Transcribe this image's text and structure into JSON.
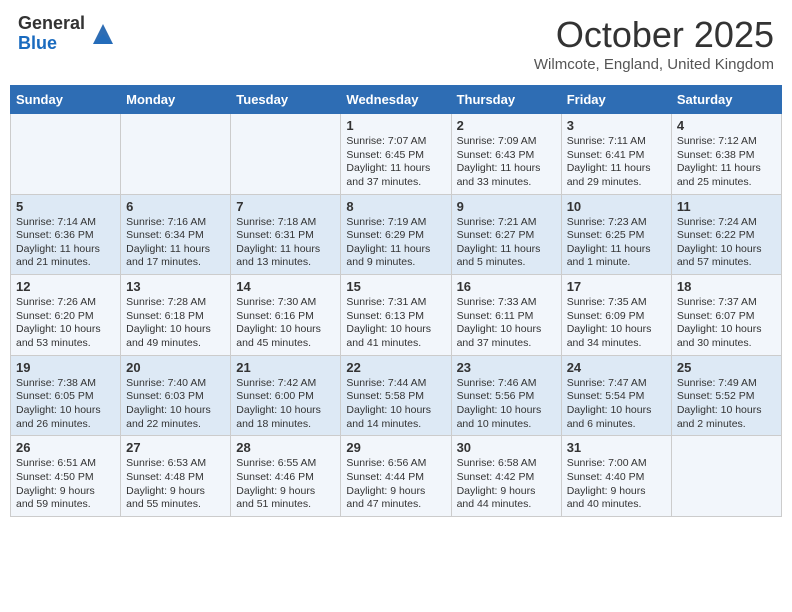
{
  "header": {
    "logo_general": "General",
    "logo_blue": "Blue",
    "title": "October 2025",
    "subtitle": "Wilmcote, England, United Kingdom"
  },
  "days_of_week": [
    "Sunday",
    "Monday",
    "Tuesday",
    "Wednesday",
    "Thursday",
    "Friday",
    "Saturday"
  ],
  "weeks": [
    [
      {
        "day": "",
        "text": ""
      },
      {
        "day": "",
        "text": ""
      },
      {
        "day": "",
        "text": ""
      },
      {
        "day": "1",
        "text": "Sunrise: 7:07 AM\nSunset: 6:45 PM\nDaylight: 11 hours and 37 minutes."
      },
      {
        "day": "2",
        "text": "Sunrise: 7:09 AM\nSunset: 6:43 PM\nDaylight: 11 hours and 33 minutes."
      },
      {
        "day": "3",
        "text": "Sunrise: 7:11 AM\nSunset: 6:41 PM\nDaylight: 11 hours and 29 minutes."
      },
      {
        "day": "4",
        "text": "Sunrise: 7:12 AM\nSunset: 6:38 PM\nDaylight: 11 hours and 25 minutes."
      }
    ],
    [
      {
        "day": "5",
        "text": "Sunrise: 7:14 AM\nSunset: 6:36 PM\nDaylight: 11 hours and 21 minutes."
      },
      {
        "day": "6",
        "text": "Sunrise: 7:16 AM\nSunset: 6:34 PM\nDaylight: 11 hours and 17 minutes."
      },
      {
        "day": "7",
        "text": "Sunrise: 7:18 AM\nSunset: 6:31 PM\nDaylight: 11 hours and 13 minutes."
      },
      {
        "day": "8",
        "text": "Sunrise: 7:19 AM\nSunset: 6:29 PM\nDaylight: 11 hours and 9 minutes."
      },
      {
        "day": "9",
        "text": "Sunrise: 7:21 AM\nSunset: 6:27 PM\nDaylight: 11 hours and 5 minutes."
      },
      {
        "day": "10",
        "text": "Sunrise: 7:23 AM\nSunset: 6:25 PM\nDaylight: 11 hours and 1 minute."
      },
      {
        "day": "11",
        "text": "Sunrise: 7:24 AM\nSunset: 6:22 PM\nDaylight: 10 hours and 57 minutes."
      }
    ],
    [
      {
        "day": "12",
        "text": "Sunrise: 7:26 AM\nSunset: 6:20 PM\nDaylight: 10 hours and 53 minutes."
      },
      {
        "day": "13",
        "text": "Sunrise: 7:28 AM\nSunset: 6:18 PM\nDaylight: 10 hours and 49 minutes."
      },
      {
        "day": "14",
        "text": "Sunrise: 7:30 AM\nSunset: 6:16 PM\nDaylight: 10 hours and 45 minutes."
      },
      {
        "day": "15",
        "text": "Sunrise: 7:31 AM\nSunset: 6:13 PM\nDaylight: 10 hours and 41 minutes."
      },
      {
        "day": "16",
        "text": "Sunrise: 7:33 AM\nSunset: 6:11 PM\nDaylight: 10 hours and 37 minutes."
      },
      {
        "day": "17",
        "text": "Sunrise: 7:35 AM\nSunset: 6:09 PM\nDaylight: 10 hours and 34 minutes."
      },
      {
        "day": "18",
        "text": "Sunrise: 7:37 AM\nSunset: 6:07 PM\nDaylight: 10 hours and 30 minutes."
      }
    ],
    [
      {
        "day": "19",
        "text": "Sunrise: 7:38 AM\nSunset: 6:05 PM\nDaylight: 10 hours and 26 minutes."
      },
      {
        "day": "20",
        "text": "Sunrise: 7:40 AM\nSunset: 6:03 PM\nDaylight: 10 hours and 22 minutes."
      },
      {
        "day": "21",
        "text": "Sunrise: 7:42 AM\nSunset: 6:00 PM\nDaylight: 10 hours and 18 minutes."
      },
      {
        "day": "22",
        "text": "Sunrise: 7:44 AM\nSunset: 5:58 PM\nDaylight: 10 hours and 14 minutes."
      },
      {
        "day": "23",
        "text": "Sunrise: 7:46 AM\nSunset: 5:56 PM\nDaylight: 10 hours and 10 minutes."
      },
      {
        "day": "24",
        "text": "Sunrise: 7:47 AM\nSunset: 5:54 PM\nDaylight: 10 hours and 6 minutes."
      },
      {
        "day": "25",
        "text": "Sunrise: 7:49 AM\nSunset: 5:52 PM\nDaylight: 10 hours and 2 minutes."
      }
    ],
    [
      {
        "day": "26",
        "text": "Sunrise: 6:51 AM\nSunset: 4:50 PM\nDaylight: 9 hours and 59 minutes."
      },
      {
        "day": "27",
        "text": "Sunrise: 6:53 AM\nSunset: 4:48 PM\nDaylight: 9 hours and 55 minutes."
      },
      {
        "day": "28",
        "text": "Sunrise: 6:55 AM\nSunset: 4:46 PM\nDaylight: 9 hours and 51 minutes."
      },
      {
        "day": "29",
        "text": "Sunrise: 6:56 AM\nSunset: 4:44 PM\nDaylight: 9 hours and 47 minutes."
      },
      {
        "day": "30",
        "text": "Sunrise: 6:58 AM\nSunset: 4:42 PM\nDaylight: 9 hours and 44 minutes."
      },
      {
        "day": "31",
        "text": "Sunrise: 7:00 AM\nSunset: 4:40 PM\nDaylight: 9 hours and 40 minutes."
      },
      {
        "day": "",
        "text": ""
      }
    ]
  ]
}
